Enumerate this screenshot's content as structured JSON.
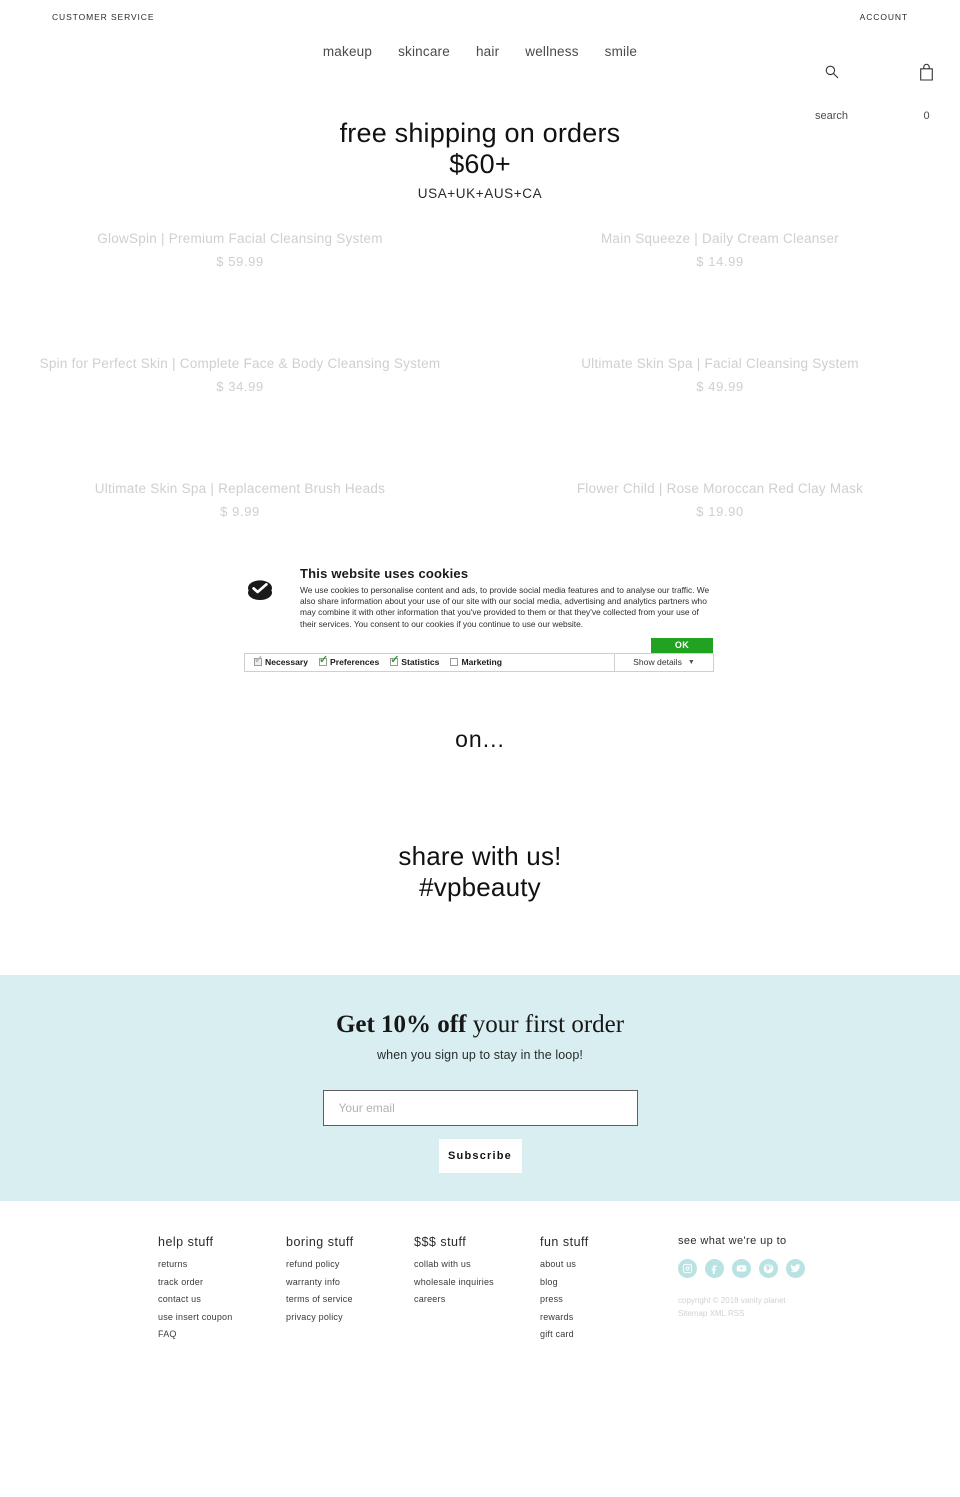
{
  "utility": {
    "left_label": "CUSTOMER SERVICE",
    "right_label": "ACCOUNT"
  },
  "nav": {
    "items": [
      {
        "label": "makeup"
      },
      {
        "label": "skincare"
      },
      {
        "label": "hair"
      },
      {
        "label": "wellness"
      },
      {
        "label": "smile"
      }
    ]
  },
  "header_icons": {
    "search_caption": "search",
    "cart_count": "0",
    "search_icon": "search-icon",
    "cart_icon": "shopping-bag-icon"
  },
  "hero": {
    "line1": "free shipping on orders",
    "line2": "$60+",
    "sub": "USA+UK+AUS+CA"
  },
  "products": [
    {
      "title": "GlowSpin | Premium Facial Cleansing System",
      "price": "$ 59.99"
    },
    {
      "title": "Main Squeeze | Daily Cream Cleanser",
      "price": "$ 14.99"
    },
    {
      "title": "Spin for Perfect Skin | Complete Face & Body Cleansing System",
      "price": "$ 34.99"
    },
    {
      "title": "Ultimate Skin Spa | Facial Cleansing System",
      "price": "$ 49.99"
    },
    {
      "title": "Ultimate Skin Spa | Replacement Brush Heads",
      "price": "$ 9.99"
    },
    {
      "title": "Flower Child | Rose Moroccan Red Clay Mask",
      "price": "$ 19.90"
    }
  ],
  "cookie": {
    "icon": "cookie-consent-icon",
    "heading": "This website uses cookies",
    "body": "We use cookies to personalise content and ads, to provide social media features and to analyse our traffic. We also share information about your use of our site with our social media, advertising and analytics partners who may combine it with other information that you've provided to them or that they've collected from your use of their services. You consent to our cookies if you continue to use our website.",
    "ok_label": "OK",
    "ok_color": "#21a221",
    "categories": [
      {
        "label": "Necessary",
        "checked": true,
        "disabled": true
      },
      {
        "label": "Preferences",
        "checked": true,
        "disabled": false
      },
      {
        "label": "Statistics",
        "checked": true,
        "disabled": false
      },
      {
        "label": "Marketing",
        "checked": false,
        "disabled": false
      }
    ],
    "details_label": "Show details"
  },
  "on_text": "on...",
  "share": {
    "line1": "share with us!",
    "line2": "#vpbeauty"
  },
  "newsletter": {
    "background": "#d8eef0",
    "title_bold": "Get 10% off ",
    "title_rest": "your first order",
    "subtitle": "when you sign up to stay in the loop!",
    "email_placeholder": "Your email",
    "email_value": "",
    "button_label": "Subscribe"
  },
  "footer": {
    "columns": [
      {
        "title": "help stuff",
        "links": [
          {
            "label": "returns"
          },
          {
            "label": "track order"
          },
          {
            "label": "contact us"
          },
          {
            "label": "use insert coupon"
          },
          {
            "label": "FAQ"
          }
        ]
      },
      {
        "title": "boring stuff",
        "links": [
          {
            "label": "refund policy"
          },
          {
            "label": "warranty info"
          },
          {
            "label": "terms of service"
          },
          {
            "label": "privacy policy"
          }
        ]
      },
      {
        "title": "$$$ stuff",
        "links": [
          {
            "label": "collab with us"
          },
          {
            "label": "wholesale inquiries"
          },
          {
            "label": "careers"
          }
        ]
      },
      {
        "title": "fun stuff",
        "links": [
          {
            "label": "about us"
          },
          {
            "label": "blog"
          },
          {
            "label": "press"
          },
          {
            "label": "rewards"
          },
          {
            "label": "gift card"
          }
        ]
      }
    ],
    "social": {
      "title": "see what we're up to",
      "color": "#b9e2e2",
      "icons": [
        {
          "name": "instagram-icon"
        },
        {
          "name": "facebook-icon"
        },
        {
          "name": "youtube-icon"
        },
        {
          "name": "pinterest-icon"
        },
        {
          "name": "twitter-icon"
        }
      ]
    },
    "copyright": "copyright © 2018 vanity planet",
    "legal_links": [
      {
        "label": "Sitemap"
      },
      {
        "label": "XML"
      },
      {
        "label": "RSS"
      }
    ]
  }
}
